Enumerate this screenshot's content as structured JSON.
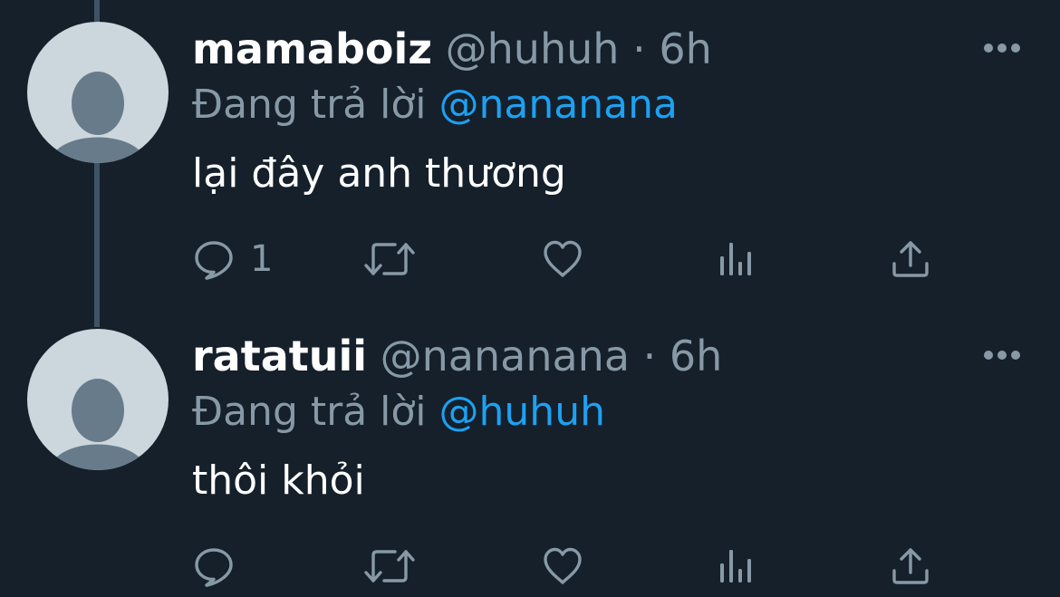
{
  "colors": {
    "background": "#15202b",
    "text_primary": "#ffffff",
    "text_secondary": "#8899a6",
    "accent": "#1da1f2",
    "avatar_bg": "#ccd6dd",
    "avatar_fg": "#687b8a",
    "thread_line": "#3d5466"
  },
  "tweets": [
    {
      "display_name": "mamaboiz",
      "handle": "@huhuh",
      "separator": "·",
      "time": "6h",
      "reply_prefix": "Đang trả lời",
      "reply_to": "@nananana",
      "text": "lại đây anh thương",
      "actions": {
        "reply_icon": "reply-icon",
        "reply_count": "1",
        "retweet_icon": "retweet-icon",
        "like_icon": "heart-icon",
        "analytics_icon": "analytics-icon",
        "share_icon": "share-icon"
      },
      "more_icon": "more-icon"
    },
    {
      "display_name": "ratatuii",
      "handle": "@nananana",
      "separator": "·",
      "time": "6h",
      "reply_prefix": "Đang trả lời",
      "reply_to": "@huhuh",
      "text": "thôi khỏi",
      "actions": {
        "reply_icon": "reply-icon",
        "reply_count": "",
        "retweet_icon": "retweet-icon",
        "like_icon": "heart-icon",
        "analytics_icon": "analytics-icon",
        "share_icon": "share-icon"
      },
      "more_icon": "more-icon"
    }
  ]
}
